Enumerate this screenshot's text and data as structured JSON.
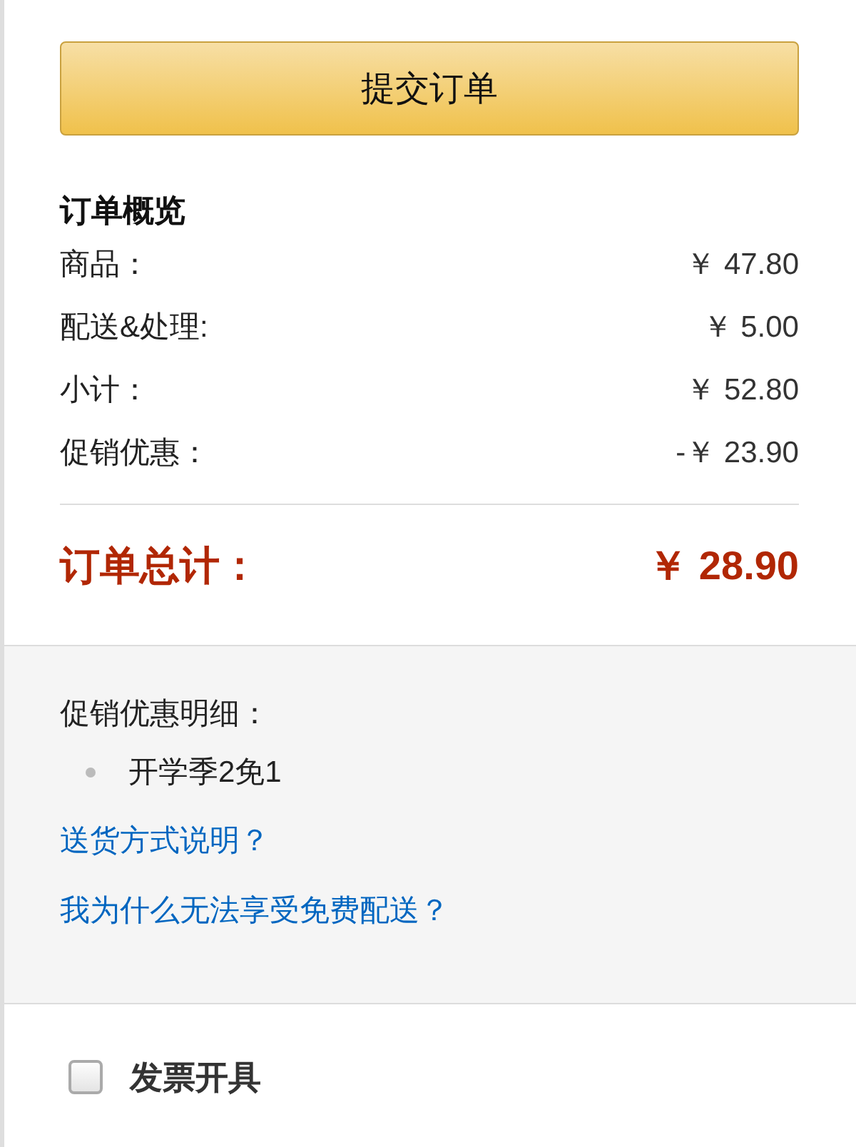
{
  "submit_button": {
    "label": "提交订单"
  },
  "summary": {
    "title": "订单概览",
    "rows": [
      {
        "label": "商品：",
        "amount": "￥ 47.80"
      },
      {
        "label": "配送&处理:",
        "amount": "￥ 5.00"
      },
      {
        "label": "小计：",
        "amount": "￥ 52.80"
      },
      {
        "label": "促销优惠：",
        "amount": "-￥ 23.90"
      }
    ],
    "total": {
      "label": "订单总计：",
      "amount": "￥ 28.90"
    }
  },
  "promotions": {
    "title": "促销优惠明细：",
    "items": [
      "开学季2免1"
    ]
  },
  "links": [
    "送货方式说明？",
    "我为什么无法享受免费配送？"
  ],
  "invoice": {
    "label": "发票开具",
    "checked": false
  }
}
